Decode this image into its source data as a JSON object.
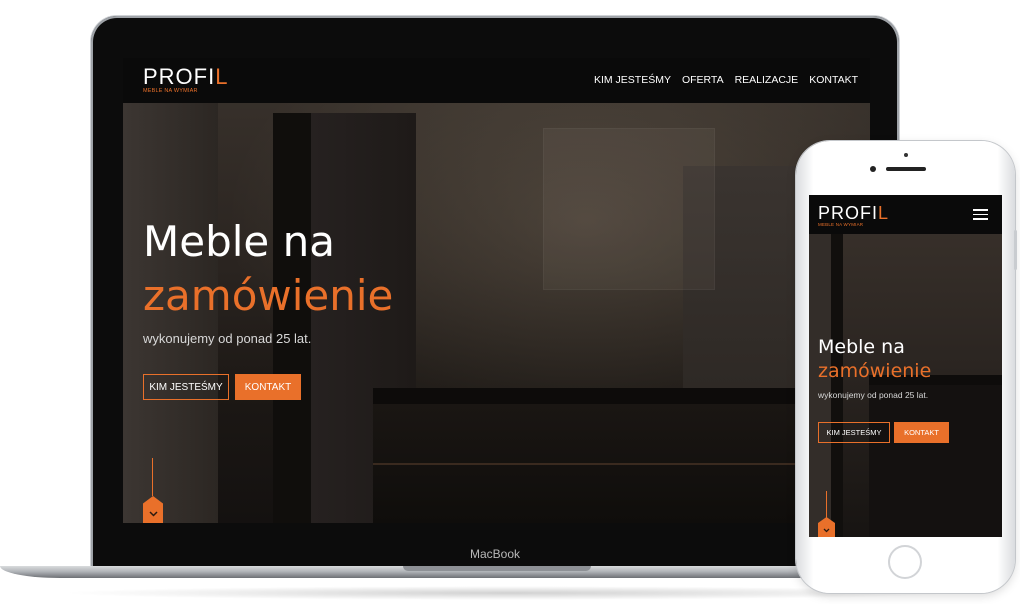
{
  "colors": {
    "accent": "#e9702a",
    "nav_bg": "#0a0a0a",
    "text": "#ffffff"
  },
  "desktop": {
    "logo": {
      "brand": "PROFI",
      "brand_mark": "L",
      "tagline": "MEBLE NA WYMIAR"
    },
    "nav": [
      "KIM JESTEŚMY",
      "OFERTA",
      "REALIZACJE",
      "KONTAKT"
    ],
    "hero": {
      "line1": "Meble na",
      "line2": "zamówienie",
      "subtitle": "wykonujemy od ponad 25 lat."
    },
    "buttons": {
      "primary": "KIM JESTEŚMY",
      "secondary": "KONTAKT"
    },
    "scroll_icon": "chevron-down-icon"
  },
  "device_label": "MacBook",
  "mobile": {
    "logo": {
      "brand": "PROFI",
      "brand_mark": "L",
      "tagline": "MEBLE NA WYMIAR"
    },
    "menu_icon": "hamburger-icon",
    "hero": {
      "line1": "Meble na",
      "line2": "zamówienie",
      "subtitle": "wykonujemy od ponad 25 lat."
    },
    "buttons": {
      "primary": "KIM JESTEŚMY",
      "secondary": "KONTAKT"
    },
    "scroll_icon": "chevron-down-icon"
  }
}
